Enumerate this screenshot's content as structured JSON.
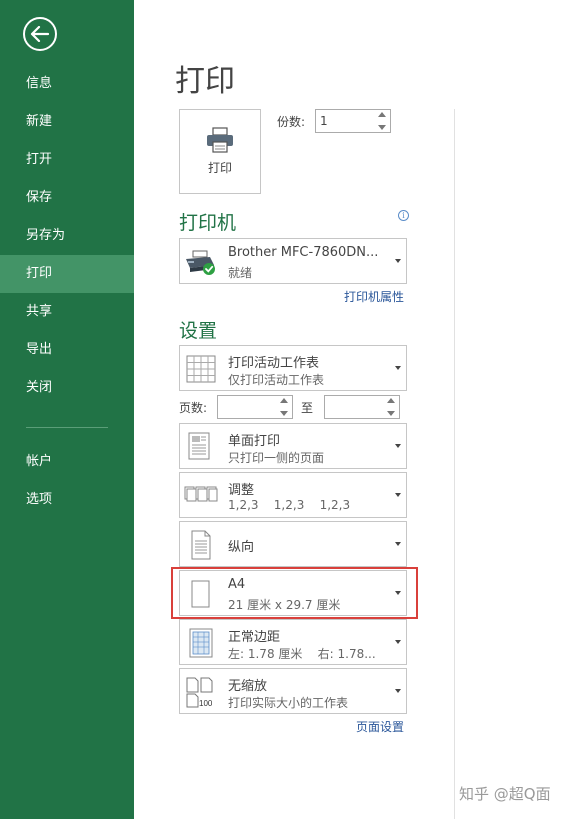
{
  "sidebar": {
    "items": [
      {
        "label": "信息",
        "active": false
      },
      {
        "label": "新建",
        "active": false
      },
      {
        "label": "打开",
        "active": false
      },
      {
        "label": "保存",
        "active": false
      },
      {
        "label": "另存为",
        "active": false
      },
      {
        "label": "打印",
        "active": true
      },
      {
        "label": "共享",
        "active": false
      },
      {
        "label": "导出",
        "active": false
      },
      {
        "label": "关闭",
        "active": false
      }
    ],
    "bottom_items": [
      {
        "label": "帐户"
      },
      {
        "label": "选项"
      }
    ]
  },
  "page_title": "打印",
  "print_button": {
    "label": "打印"
  },
  "copies": {
    "label": "份数:",
    "value": "1"
  },
  "printer": {
    "heading": "打印机",
    "name": "Brother MFC-7860DN...",
    "status": "就绪",
    "properties_link": "打印机属性"
  },
  "settings": {
    "heading": "设置",
    "scope": {
      "line1": "打印活动工作表",
      "line2": "仅打印活动工作表"
    },
    "pages": {
      "label": "页数:",
      "to_label": "至",
      "from_value": "",
      "to_value": ""
    },
    "sides": {
      "line1": "单面打印",
      "line2": "只打印一侧的页面"
    },
    "collate": {
      "line1": "调整",
      "line2": "1,2,3    1,2,3    1,2,3"
    },
    "orientation": {
      "line1": "纵向"
    },
    "paper": {
      "line1": "A4",
      "line2": "21 厘米 x 29.7 厘米"
    },
    "margins": {
      "line1": "正常边距",
      "line2": "左: 1.78 厘米    右: 1.78..."
    },
    "scaling": {
      "line1": "无缩放",
      "line2": "打印实际大小的工作表",
      "icon_text": "100"
    },
    "page_setup_link": "页面设置"
  },
  "colors": {
    "sidebar_bg": "#217346",
    "sidebar_active": "#439467",
    "accent_green": "#217346",
    "link_blue": "#2b579a",
    "highlight_red": "#d9403b"
  },
  "watermark": "知乎 @超Q面"
}
